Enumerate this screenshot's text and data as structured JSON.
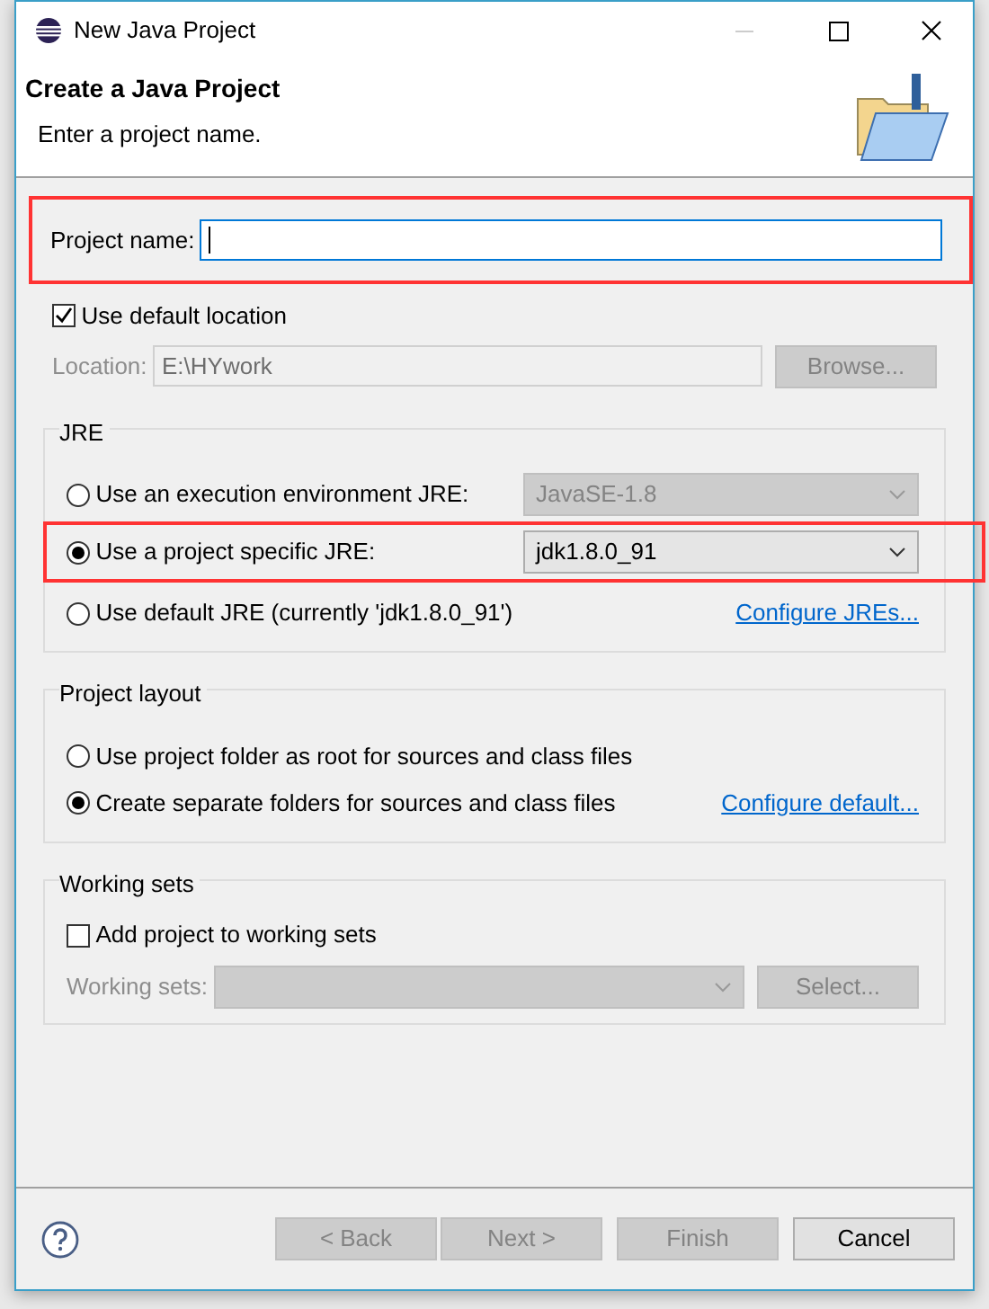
{
  "window": {
    "title": "New Java Project"
  },
  "header": {
    "title": "Create a Java Project",
    "message": "Enter a project name."
  },
  "project_name": {
    "label": "Project name:",
    "highlighted": true
  },
  "default_location": {
    "label": "Use default location",
    "checked": true
  },
  "location": {
    "label": "Location:",
    "value": "E:\\HYwork",
    "disabled": true,
    "button": {
      "label": "Browse...",
      "disabled": true
    }
  },
  "jre": {
    "title": "JRE",
    "options": [
      {
        "label": "Use an execution environment JRE:",
        "selected": false,
        "highlighted": false,
        "combo": {
          "value": "JavaSE-1.8",
          "disabled": true
        }
      },
      {
        "label": "Use a project specific JRE:",
        "selected": true,
        "highlighted": true,
        "combo": {
          "value": "jdk1.8.0_91",
          "disabled": false
        }
      },
      {
        "label": "Use default JRE (currently 'jdk1.8.0_91')",
        "selected": false,
        "highlighted": false,
        "link": "Configure JREs..."
      }
    ]
  },
  "project_layout": {
    "title": "Project layout",
    "options": [
      {
        "label": "Use project folder as root for sources and class files",
        "selected": false
      },
      {
        "label": "Create separate folders for sources and class files",
        "selected": true,
        "link": "Configure default..."
      }
    ]
  },
  "working_sets": {
    "title": "Working sets",
    "add": {
      "label": "Add project to working sets",
      "checked": false
    },
    "field": {
      "label": "Working sets:",
      "disabled": true
    },
    "button": {
      "label": "Select...",
      "disabled": true
    }
  },
  "buttons": [
    {
      "label": "< Back",
      "disabled": true
    },
    {
      "label": "Next >",
      "disabled": true
    },
    {
      "label": "Finish",
      "disabled": true
    },
    {
      "label": "Cancel",
      "disabled": false
    }
  ]
}
